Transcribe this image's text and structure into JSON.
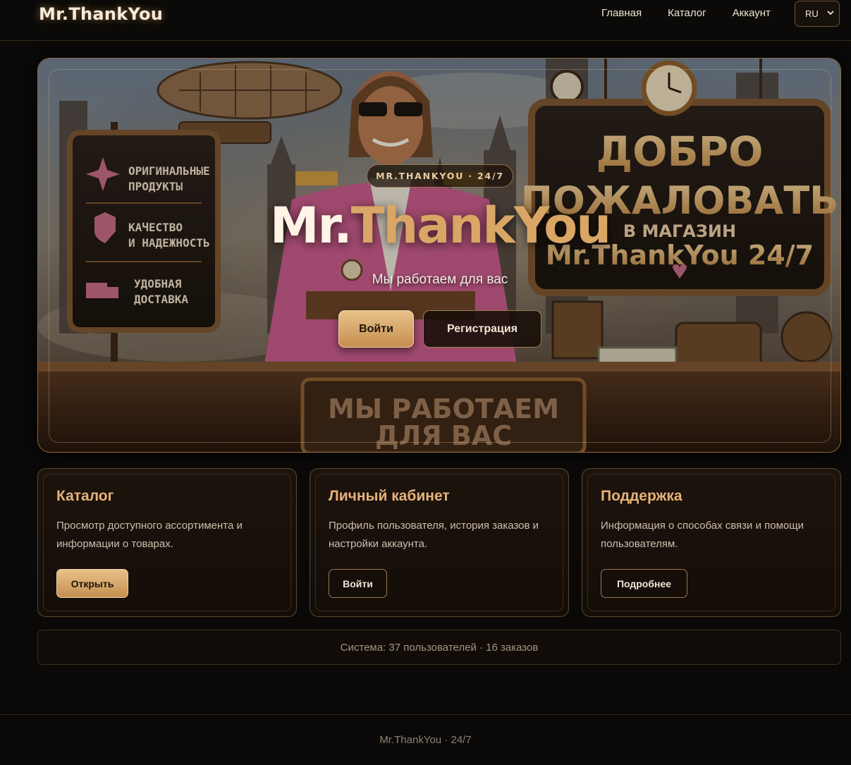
{
  "brand": {
    "part1": "Mr.",
    "part2": "ThankYou"
  },
  "nav": {
    "items": [
      {
        "label": "Главная"
      },
      {
        "label": "Каталог"
      },
      {
        "label": "Аккаунт"
      }
    ],
    "language": "RU"
  },
  "hero": {
    "badge": "MR.THANKYOU · 24/7",
    "title_part1": "Mr.",
    "title_part2": "ThankYou",
    "subtitle": "Мы работаем для вас",
    "login_label": "Войти",
    "register_label": "Регистрация",
    "art": {
      "sign_left": [
        "ОРИГИНАЛЬНЫЕ",
        "ПРОДУКТЫ",
        "КАЧЕСТВО",
        "И НАДЕЖНОСТЬ",
        "УДОБНАЯ",
        "ДОСТАВКА"
      ],
      "sign_right": [
        "ДОБРО",
        "ПОЖАЛОВАТЬ",
        "В МАГАЗИН",
        "Mr.ThankYou 24/7"
      ],
      "desk_sign": [
        "МЫ РАБОТАЕМ",
        "ДЛЯ ВАС"
      ]
    }
  },
  "cards": [
    {
      "title": "Каталог",
      "text": "Просмотр доступного ассортимента и информации о товарах.",
      "button": "Открыть"
    },
    {
      "title": "Личный кабинет",
      "text": "Профиль пользователя, история заказов и настройки аккаунта.",
      "button": "Войти"
    },
    {
      "title": "Поддержка",
      "text": "Информация о способах связи и помощи пользователям.",
      "button": "Подробнее"
    }
  ],
  "status": "Система: 37 пользователей · 16 заказов",
  "footer": "Mr.ThankYou · 24/7",
  "colors": {
    "background": "#0b0907",
    "accent_gold": "#d9a665",
    "card_title": "#e6b27a",
    "border": "#5c4630"
  }
}
